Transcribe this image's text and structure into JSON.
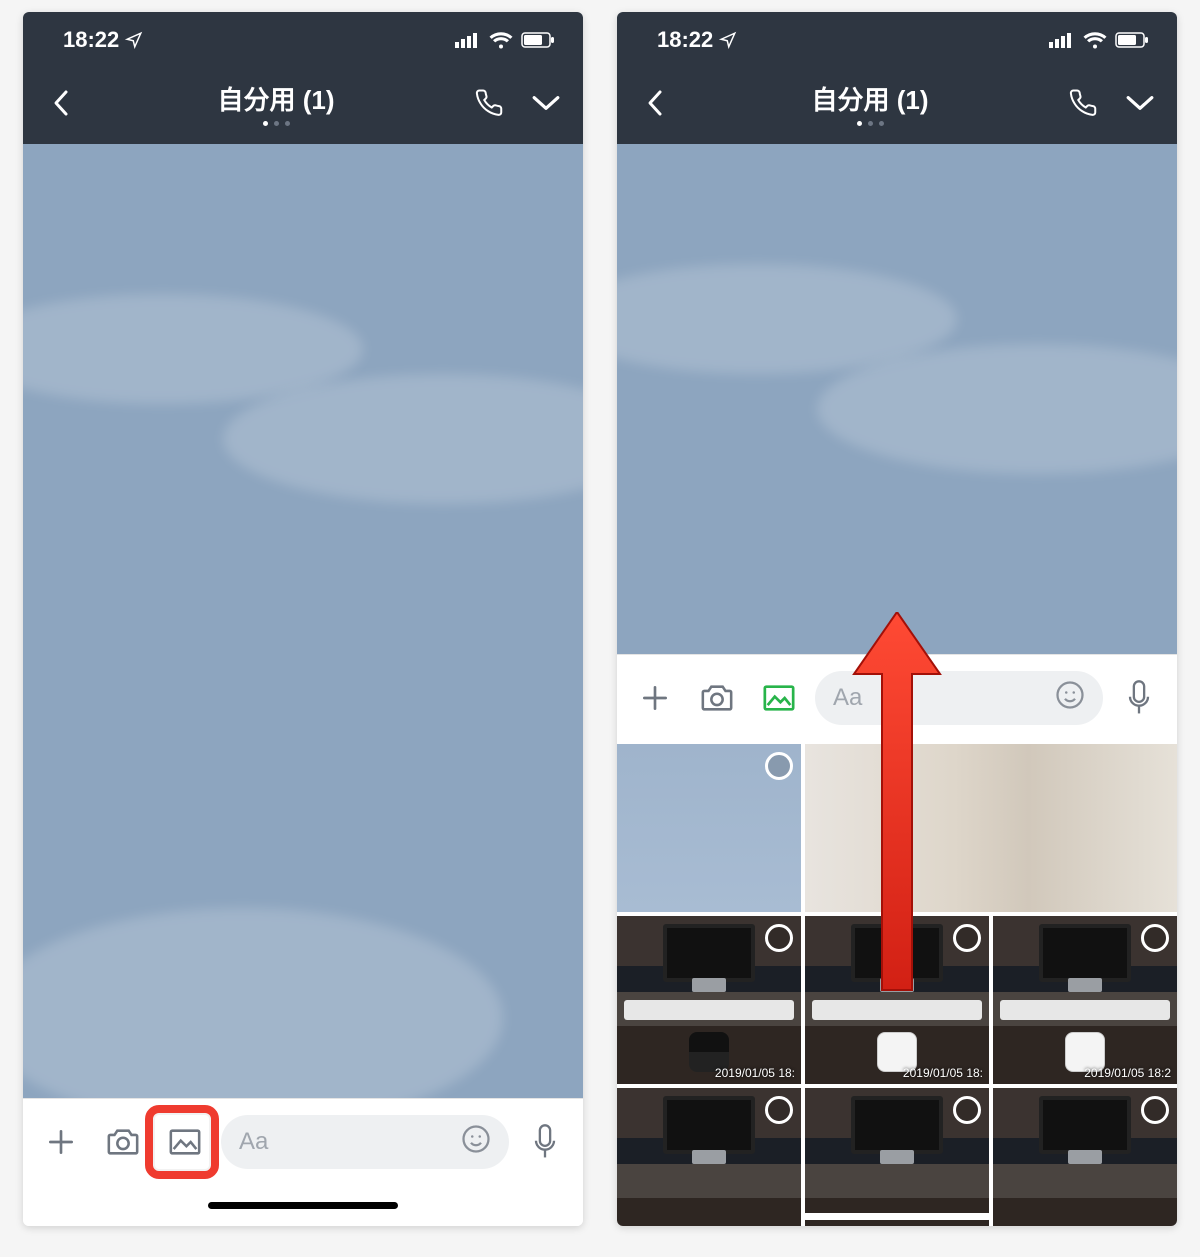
{
  "status": {
    "time": "18:22"
  },
  "header": {
    "title": "自分用 (1)"
  },
  "input": {
    "placeholder": "Aa"
  },
  "gallery": {
    "timestamps": [
      "2019/01/05 18:",
      "2019/01/05 18:",
      "2019/01/05 18:2"
    ]
  },
  "colors": {
    "highlight": "#ef3b2f",
    "accent_green": "#28b44a",
    "header_bg": "#2e3641"
  }
}
